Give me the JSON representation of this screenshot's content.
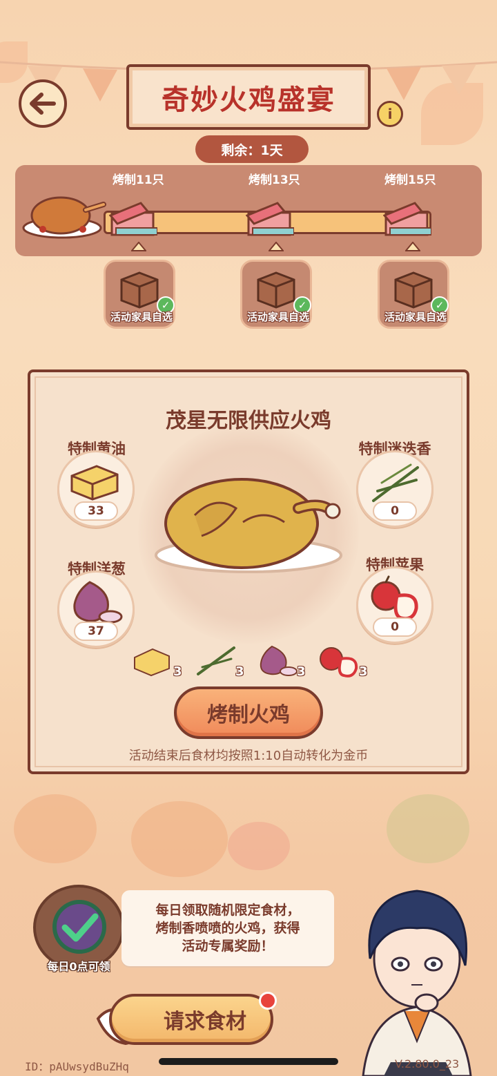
{
  "header": {
    "title": "奇妙火鸡盛宴",
    "remaining": "剩余：1天",
    "info_glyph": "i"
  },
  "progress": {
    "milestones": [
      {
        "label": "烤制11只",
        "reward": "活动家具自选",
        "claimed": true
      },
      {
        "label": "烤制13只",
        "reward": "活动家具自选",
        "claimed": true
      },
      {
        "label": "烤制15只",
        "reward": "活动家具自选",
        "claimed": true
      }
    ]
  },
  "card": {
    "title": "茂星无限供应火鸡",
    "ingredients": [
      {
        "name": "特制黄油",
        "count": "33",
        "icon": "butter-icon"
      },
      {
        "name": "特制迷迭香",
        "count": "0",
        "icon": "rosemary-icon"
      },
      {
        "name": "特制洋葱",
        "count": "37",
        "icon": "onion-icon"
      },
      {
        "name": "特制苹果",
        "count": "0",
        "icon": "apple-icon"
      }
    ],
    "costs": [
      "3",
      "3",
      "3",
      "3"
    ],
    "roast_button": "烤制火鸡",
    "note": "活动结束后食材均按照1:10自动转化为金币"
  },
  "bottom": {
    "daily_label": "每日0点可领",
    "speech_lines": [
      "每日领取随机限定食材，",
      "烤制香喷喷的火鸡，获得",
      "活动专属奖励！"
    ],
    "request_button": "请求食材",
    "id_text": "ID：pAUwsydBuZHq",
    "version": "V.2.80.0_23"
  },
  "colors": {
    "brown": "#7a3b2c",
    "title_red": "#b8322a",
    "peach": "#f9dcbc",
    "check_green": "#5cb85c"
  }
}
